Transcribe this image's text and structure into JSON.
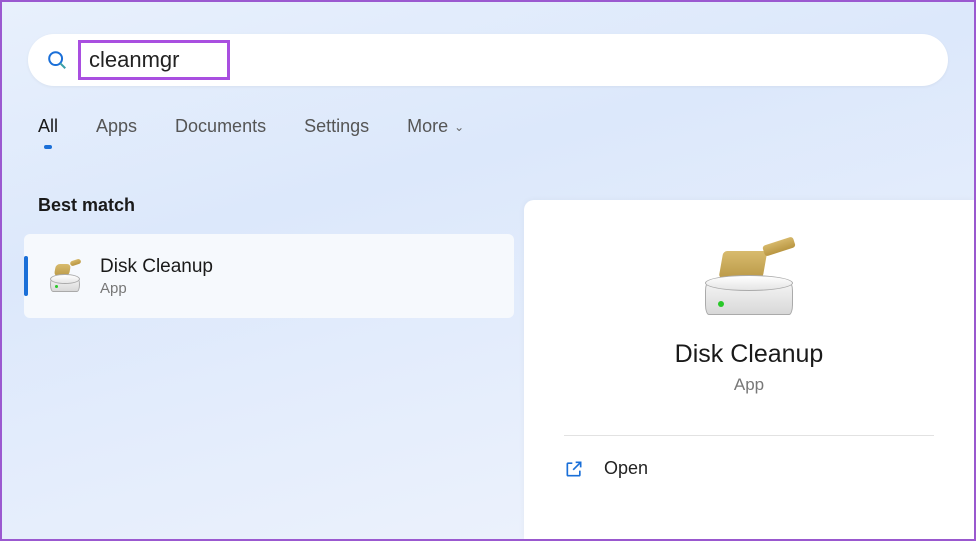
{
  "search": {
    "query": "cleanmgr"
  },
  "tabs": {
    "all": "All",
    "apps": "Apps",
    "documents": "Documents",
    "settings": "Settings",
    "more": "More"
  },
  "results": {
    "section_label": "Best match",
    "best": {
      "title": "Disk Cleanup",
      "subtitle": "App"
    }
  },
  "detail": {
    "title": "Disk Cleanup",
    "subtitle": "App",
    "actions": {
      "open": "Open"
    }
  }
}
